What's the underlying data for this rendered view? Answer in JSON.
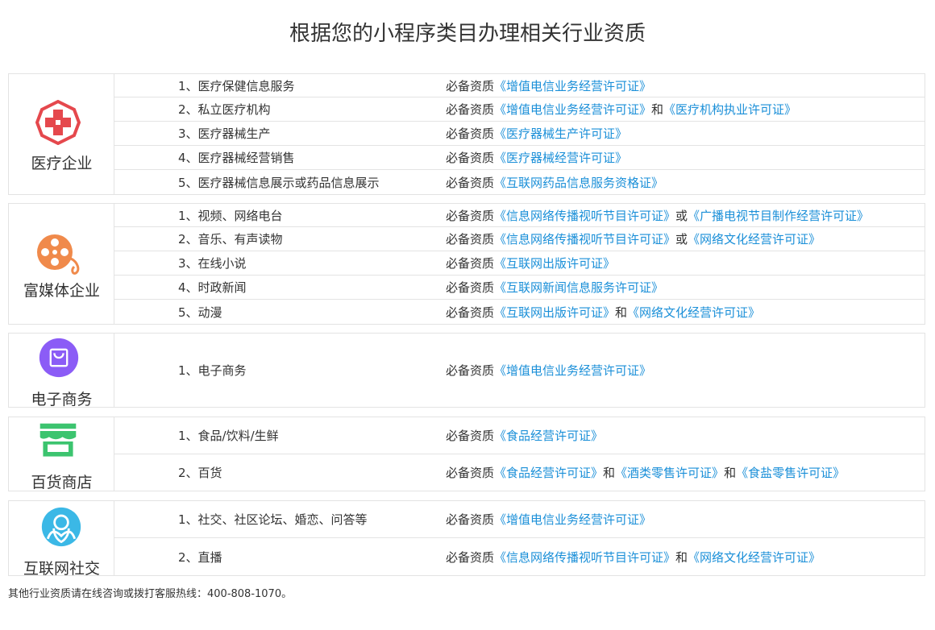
{
  "title": "根据您的小程序类目办理相关行业资质",
  "prefix": "必备资质",
  "footer": "其他行业资质请在线咨询或拨打客服热线：400-808-1070。",
  "colors": {
    "link": "#1a8fd8",
    "medical": "#e5484d",
    "media": "#f08a4b",
    "ecommerce": "#8b5cf6",
    "store": "#3cc46f",
    "social": "#3bb8e6"
  },
  "categories": [
    {
      "name": "医疗企业",
      "icon": "medical-cross-icon",
      "rows": [
        {
          "item": "1、医疗保健信息服务",
          "parts": [
            {
              "t": "lic",
              "v": "《增值电信业务经营许可证》"
            }
          ]
        },
        {
          "item": "2、私立医疗机构",
          "parts": [
            {
              "t": "lic",
              "v": "《增值电信业务经营许可证》"
            },
            {
              "t": "conj",
              "v": "和"
            },
            {
              "t": "lic",
              "v": "《医疗机构执业许可证》"
            }
          ]
        },
        {
          "item": "3、医疗器械生产",
          "parts": [
            {
              "t": "lic",
              "v": "《医疗器械生产许可证》"
            }
          ]
        },
        {
          "item": "4、医疗器械经营销售",
          "parts": [
            {
              "t": "lic",
              "v": "《医疗器械经营许可证》"
            }
          ]
        },
        {
          "item": "5、医疗器械信息展示或药品信息展示",
          "parts": [
            {
              "t": "lic",
              "v": "《互联网药品信息服务资格证》"
            }
          ]
        }
      ]
    },
    {
      "name": "富媒体企业",
      "icon": "film-reel-icon",
      "rows": [
        {
          "item": "1、视频、网络电台",
          "parts": [
            {
              "t": "lic",
              "v": "《信息网络传播视听节目许可证》"
            },
            {
              "t": "conj",
              "v": "或"
            },
            {
              "t": "lic",
              "v": "《广播电视节目制作经营许可证》"
            }
          ]
        },
        {
          "item": "2、音乐、有声读物",
          "parts": [
            {
              "t": "lic",
              "v": "《信息网络传播视听节目许可证》"
            },
            {
              "t": "conj",
              "v": "或"
            },
            {
              "t": "lic",
              "v": "《网络文化经营许可证》"
            }
          ]
        },
        {
          "item": "3、在线小说",
          "parts": [
            {
              "t": "lic",
              "v": "《互联网出版许可证》"
            }
          ]
        },
        {
          "item": "4、时政新闻",
          "parts": [
            {
              "t": "lic",
              "v": "《互联网新闻信息服务许可证》"
            }
          ]
        },
        {
          "item": "5、动漫",
          "parts": [
            {
              "t": "lic",
              "v": "《互联网出版许可证》"
            },
            {
              "t": "conj",
              "v": "和"
            },
            {
              "t": "lic",
              "v": "《网络文化经营许可证》"
            }
          ]
        }
      ]
    },
    {
      "name": "电子商务",
      "icon": "shopping-bag-icon",
      "rows": [
        {
          "item": "1、电子商务",
          "parts": [
            {
              "t": "lic",
              "v": "《增值电信业务经营许可证》"
            }
          ]
        }
      ]
    },
    {
      "name": "百货商店",
      "icon": "storefront-icon",
      "rows": [
        {
          "item": "1、食品/饮料/生鲜",
          "parts": [
            {
              "t": "lic",
              "v": "《食品经营许可证》"
            }
          ]
        },
        {
          "item": "2、百货",
          "parts": [
            {
              "t": "lic",
              "v": "《食品经营许可证》"
            },
            {
              "t": "conj",
              "v": "和"
            },
            {
              "t": "lic",
              "v": "《酒类零售许可证》"
            },
            {
              "t": "conj",
              "v": "和"
            },
            {
              "t": "lic",
              "v": "《食盐零售许可证》"
            }
          ]
        }
      ]
    },
    {
      "name": "互联网社交",
      "icon": "people-hug-icon",
      "rows": [
        {
          "item": "1、社交、社区论坛、婚恋、问答等",
          "parts": [
            {
              "t": "lic",
              "v": "《增值电信业务经营许可证》"
            }
          ]
        },
        {
          "item": "2、直播",
          "parts": [
            {
              "t": "lic",
              "v": "《信息网络传播视听节目许可证》"
            },
            {
              "t": "conj",
              "v": "和"
            },
            {
              "t": "lic",
              "v": "《网络文化经营许可证》"
            }
          ]
        }
      ]
    }
  ]
}
